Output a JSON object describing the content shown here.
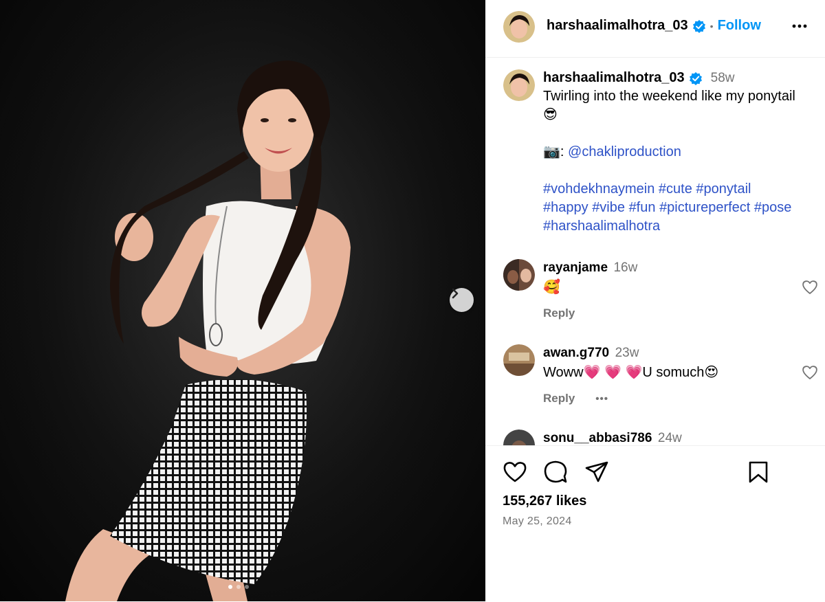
{
  "post": {
    "author": "harshaalimalhotra_03",
    "follow_label": "Follow",
    "separator": "•",
    "caption_age": "58w",
    "caption_line1": "Twirling into the weekend like my ponytail",
    "caption_emoji1": "😎",
    "credit_prefix": "📷:",
    "credit_handle": "@chakliproduction",
    "hashtags_line1": [
      "#vohdekhnaymein",
      "#cute",
      "#ponytail"
    ],
    "hashtags_line2": [
      "#happy",
      "#vibe",
      "#fun",
      "#pictureperfect",
      "#pose"
    ],
    "hashtags_line3": [
      "#harshaalimalhotra"
    ]
  },
  "comments": [
    {
      "user": "rayanjame",
      "time": "16w",
      "text": "🥰",
      "reply_label": "Reply"
    },
    {
      "user": "awan.g770",
      "time": "23w",
      "text": "Woww💗 💗 💗U somuch😍",
      "reply_label": "Reply",
      "more": "•••"
    },
    {
      "user": "sonu__abbasi786",
      "time": "24w"
    }
  ],
  "stats": {
    "likes": "155,267 likes",
    "date": "May 25, 2024"
  },
  "carousel": {
    "current": 1,
    "total": 3
  },
  "colors": {
    "accent": "#0095f6",
    "verified": "#0095f6",
    "muted": "#737373"
  },
  "icons": [
    "chevron-right-icon",
    "verified-badge-icon",
    "more-icon",
    "heart-icon",
    "comment-icon",
    "share-icon",
    "bookmark-icon"
  ]
}
